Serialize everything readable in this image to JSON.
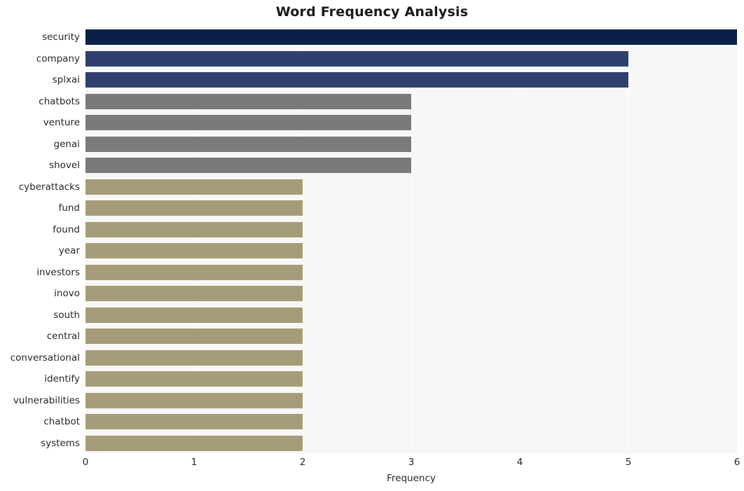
{
  "chart_data": {
    "type": "bar",
    "orientation": "horizontal",
    "title": "Word Frequency Analysis",
    "xlabel": "Frequency",
    "ylabel": "",
    "xlim": [
      0,
      6
    ],
    "xticks": [
      "0",
      "1",
      "2",
      "3",
      "4",
      "5",
      "6"
    ],
    "grid": true,
    "legend": null,
    "categories": [
      "security",
      "company",
      "splxai",
      "chatbots",
      "venture",
      "genai",
      "shovel",
      "cyberattacks",
      "fund",
      "found",
      "year",
      "investors",
      "inovo",
      "south",
      "central",
      "conversational",
      "identify",
      "vulnerabilities",
      "chatbot",
      "systems"
    ],
    "values": [
      6,
      5,
      5,
      3,
      3,
      3,
      3,
      2,
      2,
      2,
      2,
      2,
      2,
      2,
      2,
      2,
      2,
      2,
      2,
      2
    ],
    "bar_colors": [
      "#0b2049",
      "#2f406f",
      "#2f406f",
      "#7c7a79",
      "#7c7a79",
      "#7c7a79",
      "#7c7a79",
      "#a69c78",
      "#a69c78",
      "#a69c78",
      "#a69c78",
      "#a69c78",
      "#a69c78",
      "#a69c78",
      "#a69c78",
      "#a69c78",
      "#a69c78",
      "#a69c78",
      "#a69c78",
      "#a69c78"
    ],
    "plot_background": "#f7f7f7",
    "gridline_color": "#ffffff"
  }
}
